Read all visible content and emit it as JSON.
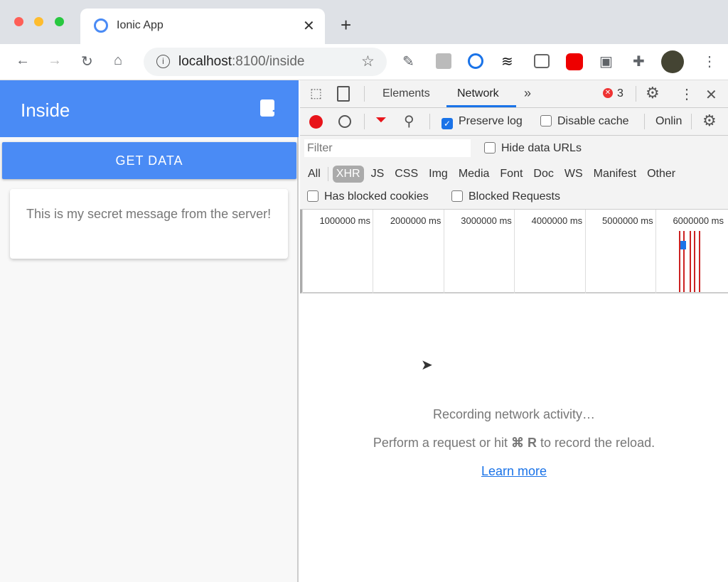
{
  "browser": {
    "tab_title": "Ionic App",
    "url_host": "localhost",
    "url_rest": ":8100/inside"
  },
  "app": {
    "title": "Inside",
    "get_data_label": "GET DATA",
    "message": "This is my secret message from the server!"
  },
  "devtools": {
    "tabs": [
      "Elements",
      "Network"
    ],
    "active_tab": "Network",
    "error_count": "3",
    "preserve_log": "Preserve log",
    "preserve_log_checked": true,
    "disable_cache": "Disable cache",
    "disable_cache_checked": false,
    "throttle": "Onlin",
    "filter_placeholder": "Filter",
    "hide_data_urls": "Hide data URLs",
    "types": [
      "All",
      "XHR",
      "JS",
      "CSS",
      "Img",
      "Media",
      "Font",
      "Doc",
      "WS",
      "Manifest",
      "Other"
    ],
    "active_type": "XHR",
    "has_blocked_cookies": "Has blocked cookies",
    "blocked_requests": "Blocked Requests",
    "timeline_ticks": [
      "1000000 ms",
      "2000000 ms",
      "3000000 ms",
      "4000000 ms",
      "5000000 ms",
      "6000000 ms"
    ],
    "empty": {
      "recording": "Recording network activity…",
      "hint_pre": "Perform a request or hit",
      "hint_key": "⌘ R",
      "hint_post": "to record the reload.",
      "learn_more": "Learn more"
    }
  },
  "colors": {
    "ionic_primary": "#4a8bf5",
    "record": "#e8141a",
    "link": "#1a73e8"
  }
}
